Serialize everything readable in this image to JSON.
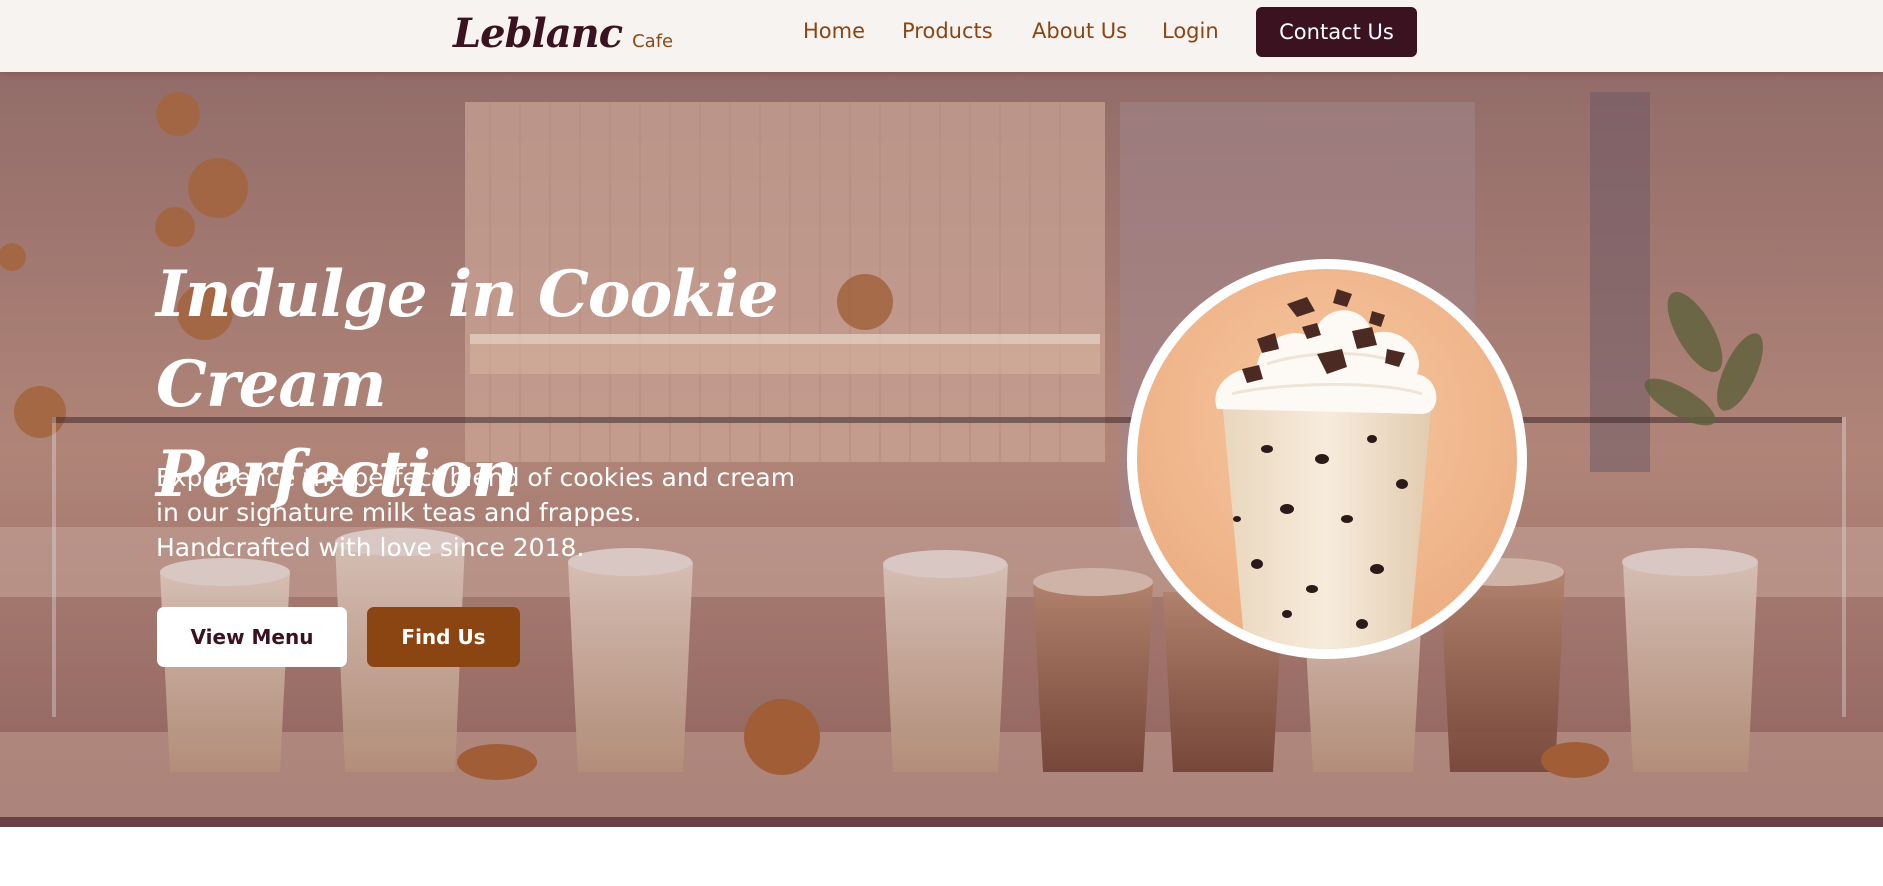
{
  "header": {
    "logo_main": "Leblanc",
    "logo_sub": "Cafe",
    "nav": [
      "Home",
      "Products",
      "About Us",
      "Login"
    ],
    "contact_label": "Contact Us"
  },
  "hero": {
    "title_line1": "Indulge in Cookie Cream",
    "title_line2": "Perfection",
    "subtitle_line1": "Experience the perfect blend of cookies and cream",
    "subtitle_line2": "in our signature milk teas and frappes.",
    "subtitle_line3": "Handcrafted with love since 2018.",
    "primary_button": "View Menu",
    "secondary_button": "Find Us"
  },
  "colors": {
    "brand_dark": "#3a1220",
    "accent_brown": "#8b4513",
    "header_bg": "#f7f3f1"
  }
}
